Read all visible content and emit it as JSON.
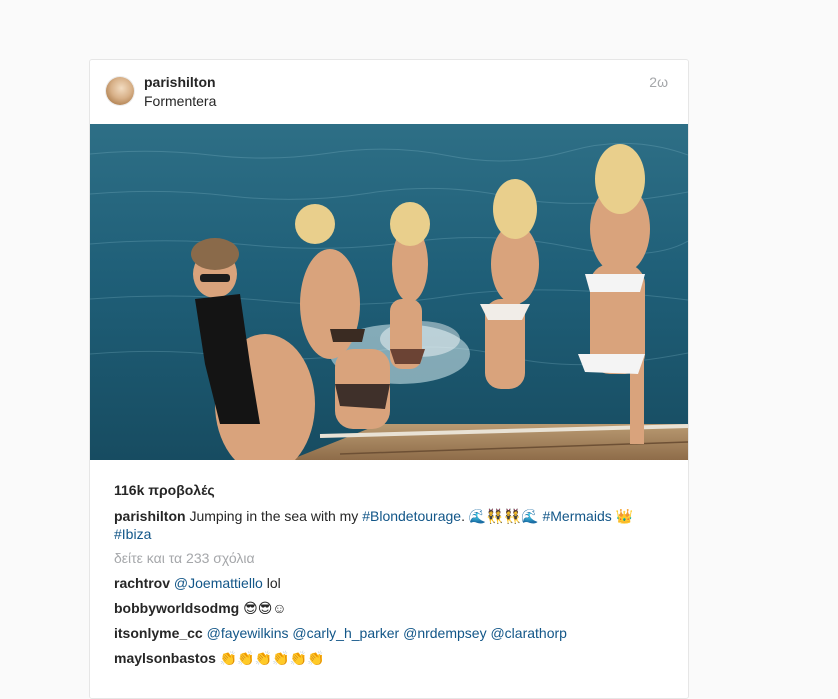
{
  "post": {
    "username": "parishilton",
    "location": "Formentera",
    "time_ago": "2ω",
    "views": "116k προβολές",
    "caption": {
      "username": "parishilton",
      "text_1": "Jumping in the sea with my",
      "hashtag_1": "#Blondetourage",
      "text_2": ". 🌊👯👯🌊",
      "hashtag_2": "#Mermaids",
      "text_3": "👑",
      "hashtag_3": "#Ibiza"
    },
    "view_all_comments": "δείτε και τα 233 σχόλια",
    "comments": [
      {
        "username": "rachtrov",
        "mention": "@Joemattiello",
        "text": "lol"
      },
      {
        "username": "bobbyworldsodmg",
        "text": "😎😎☺"
      },
      {
        "username": "itsonlyme_cc",
        "mentions": [
          "@fayewilkins",
          "@carly_h_parker",
          "@nrdempsey",
          "@clarathorp"
        ]
      },
      {
        "username": "maylsonbastos",
        "text": "👏👏👏👏👏👏"
      }
    ]
  },
  "colors": {
    "link": "#125688",
    "muted": "#a5a7aa",
    "text": "#262626",
    "background": "#fafafa"
  }
}
